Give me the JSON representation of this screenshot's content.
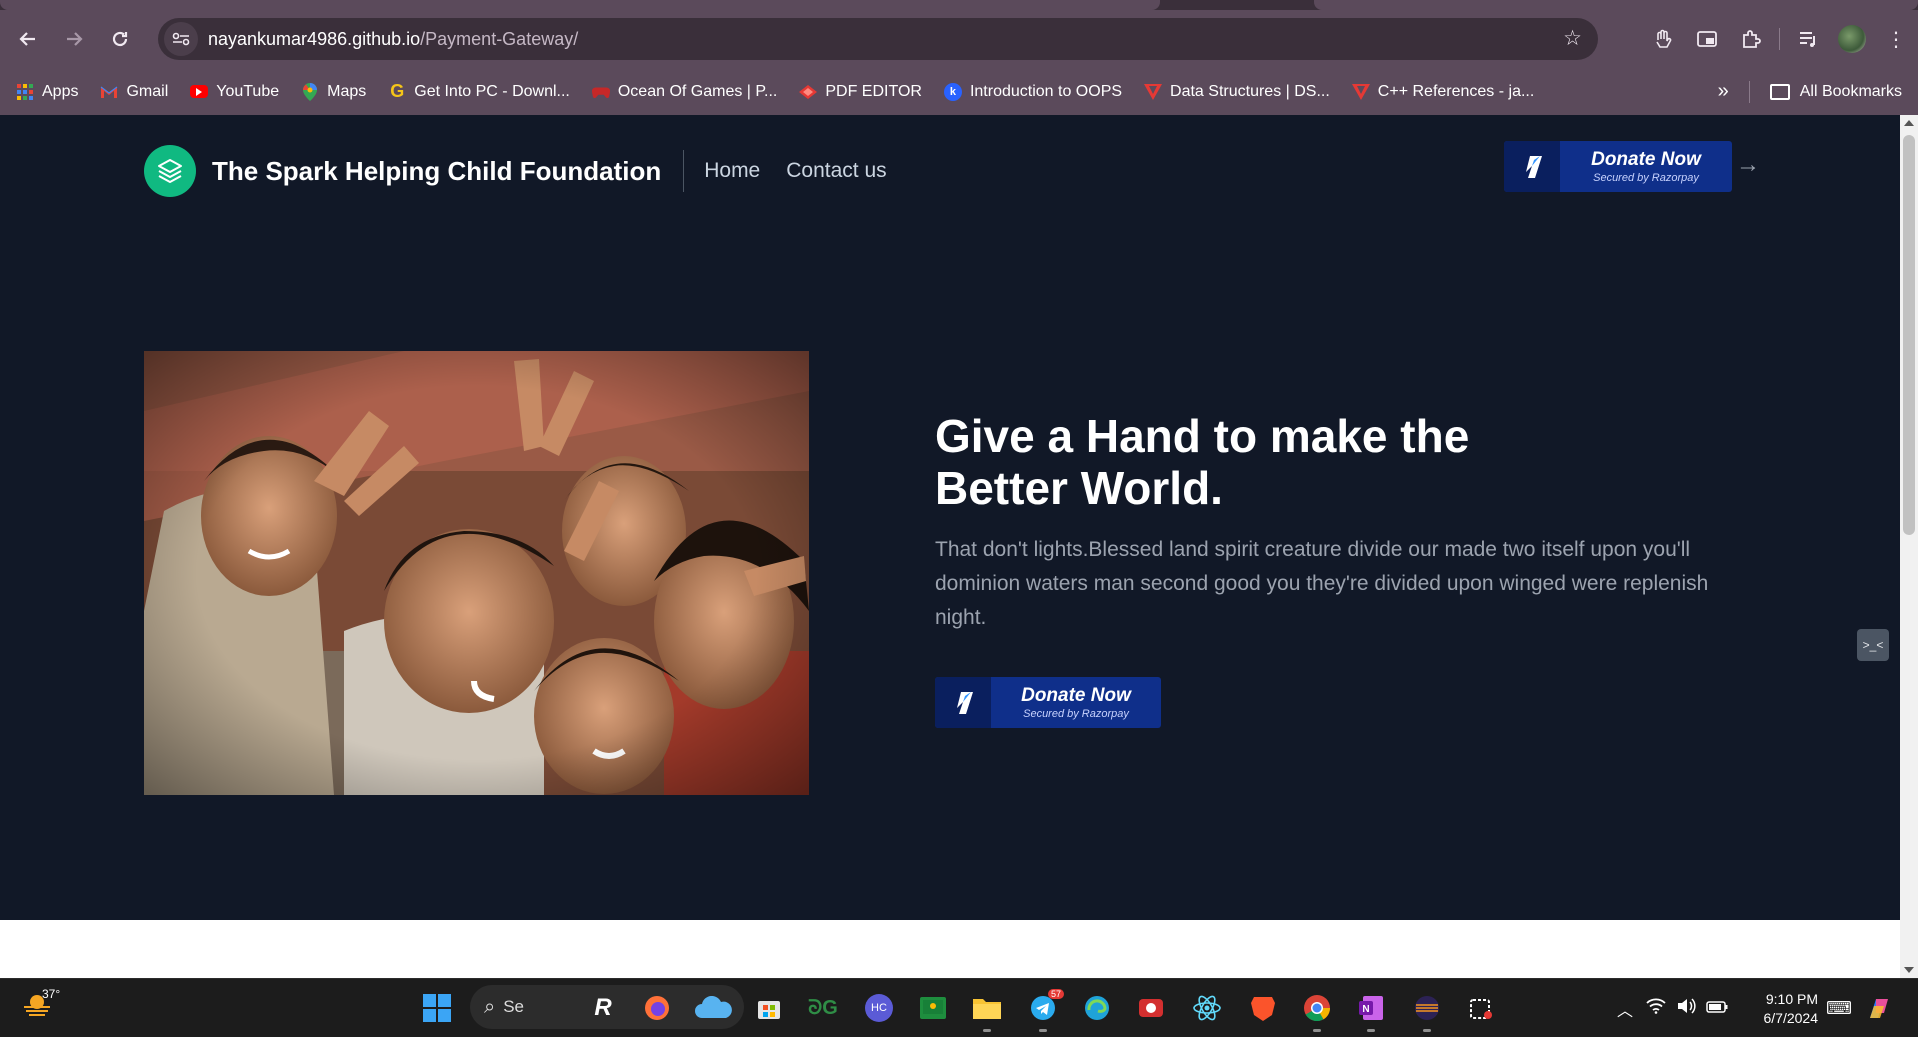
{
  "browser": {
    "url_host": "nayankumar4986.github.io",
    "url_path": "/Payment-Gateway/",
    "bookmarks": [
      {
        "label": "Apps",
        "icon": "apps-grid-icon",
        "color": "#ea4335"
      },
      {
        "label": "Gmail",
        "icon": "gmail-icon",
        "color": "#ea4335"
      },
      {
        "label": "YouTube",
        "icon": "youtube-icon",
        "color": "#ff0000"
      },
      {
        "label": "Maps",
        "icon": "maps-icon",
        "color": "#34a853"
      },
      {
        "label": "Get Into PC - Downl...",
        "icon": "getintopc-icon",
        "color": "#f5c518"
      },
      {
        "label": "Ocean Of Games | P...",
        "icon": "gamepad-icon",
        "color": "#c62828"
      },
      {
        "label": "PDF EDITOR",
        "icon": "pdf-icon",
        "color": "#e53935"
      },
      {
        "label": "Introduction to OOPS",
        "icon": "bookmark-site-icon",
        "color": "#2962ff"
      },
      {
        "label": "Data Structures | DS...",
        "icon": "chevron-logo-icon",
        "color": "#e53935"
      },
      {
        "label": "C++ References - ja...",
        "icon": "chevron-logo-icon",
        "color": "#e53935"
      }
    ],
    "all_bookmarks": "All Bookmarks"
  },
  "site": {
    "brand": "The Spark Helping Child Foundation",
    "nav": [
      "Home",
      "Contact us"
    ],
    "donate_main": "Donate Now",
    "donate_sub": "Secured by Razorpay",
    "hero_title": "Give a Hand to make the Better World.",
    "hero_text": "That don't lights.Blessed land spirit creature divide our made two itself upon you'll dominion waters man second good you they're divided upon winged were replenish night.",
    "side_chip": ">_<",
    "accent": "#10b981",
    "razorpay_blue": "#0f2f8a"
  },
  "taskbar": {
    "weather": "37°",
    "search": "Se",
    "time": "9:10 PM",
    "date": "6/7/2024",
    "telegram_badge": "57"
  }
}
